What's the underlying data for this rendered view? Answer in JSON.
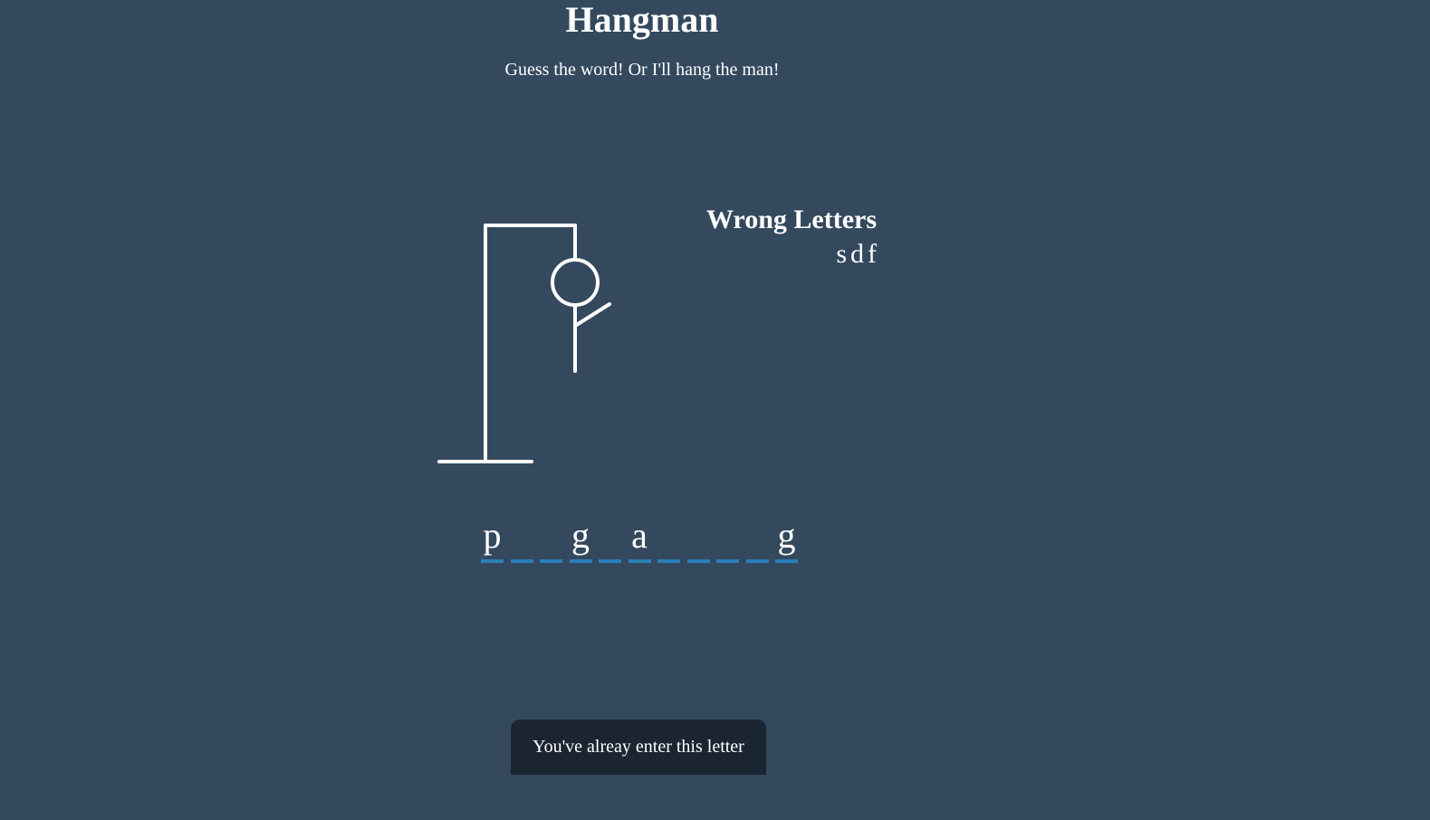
{
  "header": {
    "title": "Hangman",
    "subtitle": "Guess the word! Or I'll hang the man!"
  },
  "wrong_letters": {
    "title": "Wrong Letters",
    "letters": [
      "s",
      "d",
      "f"
    ]
  },
  "word": {
    "letters": [
      "p",
      "",
      "",
      "g",
      "",
      "a",
      "",
      "",
      "",
      "",
      "g"
    ]
  },
  "figure": {
    "parts_shown": [
      "head",
      "body",
      "left-arm"
    ],
    "stroke_color": "#ffffff"
  },
  "notification": {
    "text": "You've alreay enter this letter"
  },
  "colors": {
    "background": "#34495e",
    "underline": "#2980b9",
    "notification_bg": "#1a2531"
  }
}
